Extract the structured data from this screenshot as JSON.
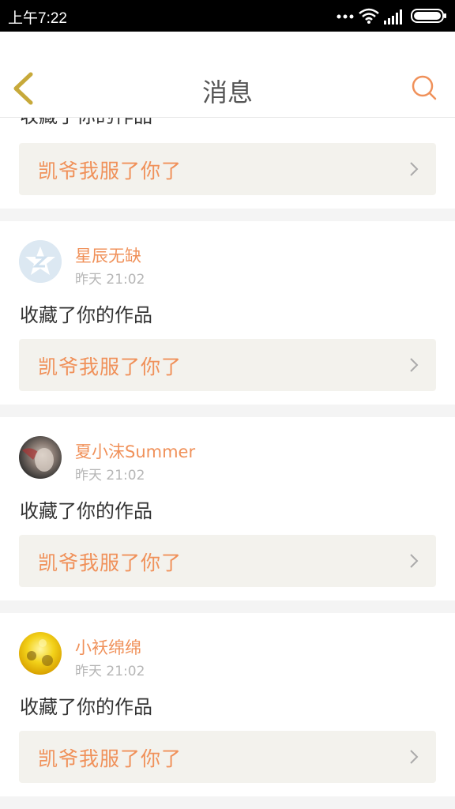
{
  "status_bar": {
    "time": "上午7:22"
  },
  "header": {
    "title": "消息"
  },
  "partial_card": {
    "action": "收藏了你的作品",
    "work_title": "凯爷我服了你了"
  },
  "messages": [
    {
      "username": "星辰无缺",
      "time": "昨天 21:02",
      "action": "收藏了你的作品",
      "work_title": "凯爷我服了你了"
    },
    {
      "username": "夏小沫Summer",
      "time": "昨天 21:02",
      "action": "收藏了你的作品",
      "work_title": "凯爷我服了你了"
    },
    {
      "username": "小袄绵绵",
      "time": "昨天 21:02",
      "action": "收藏了你的作品",
      "work_title": "凯爷我服了你了"
    }
  ],
  "colors": {
    "accent": "#f0915a",
    "back_icon": "#c7a93a",
    "ref_bg": "#f3f2ed"
  },
  "icons": [
    "back-arrow-icon",
    "search-icon",
    "chevron-right-icon",
    "wifi-icon",
    "signal-icon",
    "battery-icon"
  ]
}
